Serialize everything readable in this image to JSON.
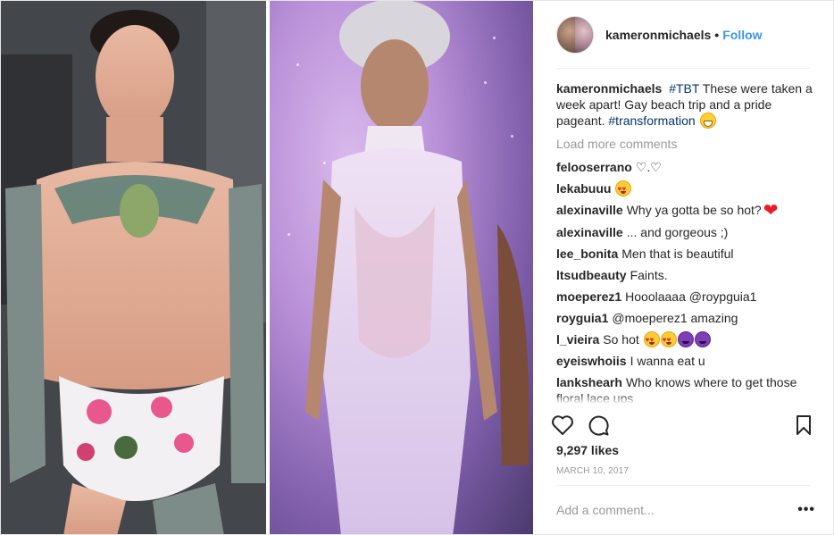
{
  "post": {
    "author": "kameronmichaels",
    "header_dot": "•",
    "follow_label": "Follow",
    "caption": {
      "user": "kameronmichaels",
      "parts": [
        "#TBT",
        " These were taken a week apart! Gay beach trip and a pride pageant. ",
        "#transformation"
      ]
    },
    "load_more_label": "Load more comments",
    "comments": [
      {
        "user": "felooserrano",
        "text": "♡.♡"
      },
      {
        "user": "lekabuuu",
        "text": ""
      },
      {
        "user": "alexinaville",
        "text": "Why ya gotta be so hot?"
      },
      {
        "user": "alexinaville",
        "text": "... and gorgeous ;)"
      },
      {
        "user": "lee_bonita",
        "text": "Men that is beautiful"
      },
      {
        "user": "ltsudbeauty",
        "text": "Faints."
      },
      {
        "user": "moeperez1",
        "text": "Hooolaaaa @roypguia1"
      },
      {
        "user": "royguia1",
        "text": "@moeperez1 amazing"
      },
      {
        "user": "l_vieira",
        "text": "So hot"
      },
      {
        "user": "eyeiswhoiis",
        "text": "I wanna eat u"
      },
      {
        "user": "lankshearh",
        "text": "Who knows where to get those floral lace ups"
      }
    ],
    "likes": "9,297 likes",
    "date": "MARCH 10, 2017",
    "add_comment_placeholder": "Add a comment...",
    "more_label": "•••",
    "icons": [
      "heart-icon",
      "comment-icon",
      "bookmark-icon",
      "grinning-emoji",
      "heart-eyes-emoji",
      "devil-emoji",
      "red-heart-emoji"
    ],
    "colors": {
      "link": "#3897f0",
      "hashtag": "#003569",
      "muted": "#999999",
      "text": "#262626"
    }
  }
}
